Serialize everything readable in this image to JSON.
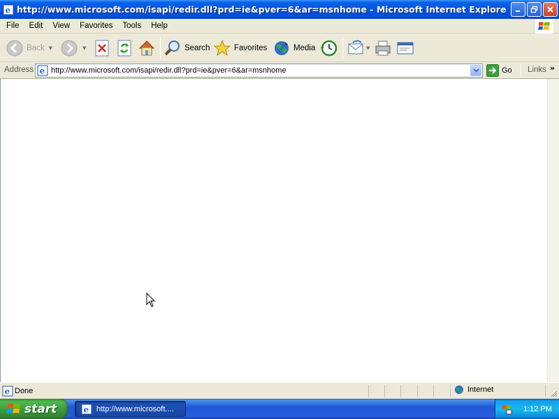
{
  "window": {
    "title": "http://www.microsoft.com/isapi/redir.dll?prd=ie&pver=6&ar=msnhome - Microsoft Internet Explorer"
  },
  "menu": [
    "File",
    "Edit",
    "View",
    "Favorites",
    "Tools",
    "Help"
  ],
  "toolbar": {
    "back": "Back",
    "search": "Search",
    "favorites": "Favorites",
    "media": "Media"
  },
  "address": {
    "label": "Address",
    "url": "http://www.microsoft.com/isapi/redir.dll?prd=ie&pver=6&ar=msnhome",
    "go": "Go",
    "links": "Links"
  },
  "status": {
    "text": "Done",
    "zone": "Internet"
  },
  "taskbar": {
    "start": "start",
    "task_label": "http://www.microsoft....",
    "clock": "1:12 PM"
  },
  "colors": {
    "titlebar": "#0054e3",
    "chrome": "#ece9d8",
    "taskbar": "#245dda",
    "start": "#3a9a3a",
    "tray": "#18b9f0"
  }
}
